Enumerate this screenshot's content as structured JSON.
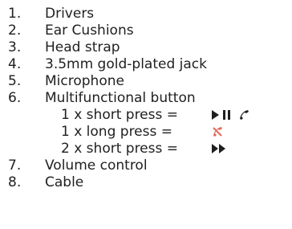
{
  "items": [
    {
      "number": "1.",
      "label": "Drivers"
    },
    {
      "number": "2.",
      "label": "Ear Cushions"
    },
    {
      "number": "3.",
      "label": "Head strap"
    },
    {
      "number": "4.",
      "label": "3.5mm gold-plated jack"
    },
    {
      "number": "5.",
      "label": "Microphone"
    },
    {
      "number": "6.",
      "label": "Multifunctional button"
    },
    {
      "number": "7.",
      "label": "Volume control"
    },
    {
      "number": "8.",
      "label": "Cable"
    }
  ],
  "button_actions": [
    {
      "label": "1 x short press =",
      "icons": [
        "play-pause-icon",
        "answer-call-icon"
      ]
    },
    {
      "label": "1 x long press =",
      "icons": [
        "reject-call-icon"
      ]
    },
    {
      "label": "2 x short press =",
      "icons": [
        "next-track-icon"
      ]
    }
  ],
  "colors": {
    "text": "#1f1f1f",
    "reject_icon": "#e06a5a"
  }
}
